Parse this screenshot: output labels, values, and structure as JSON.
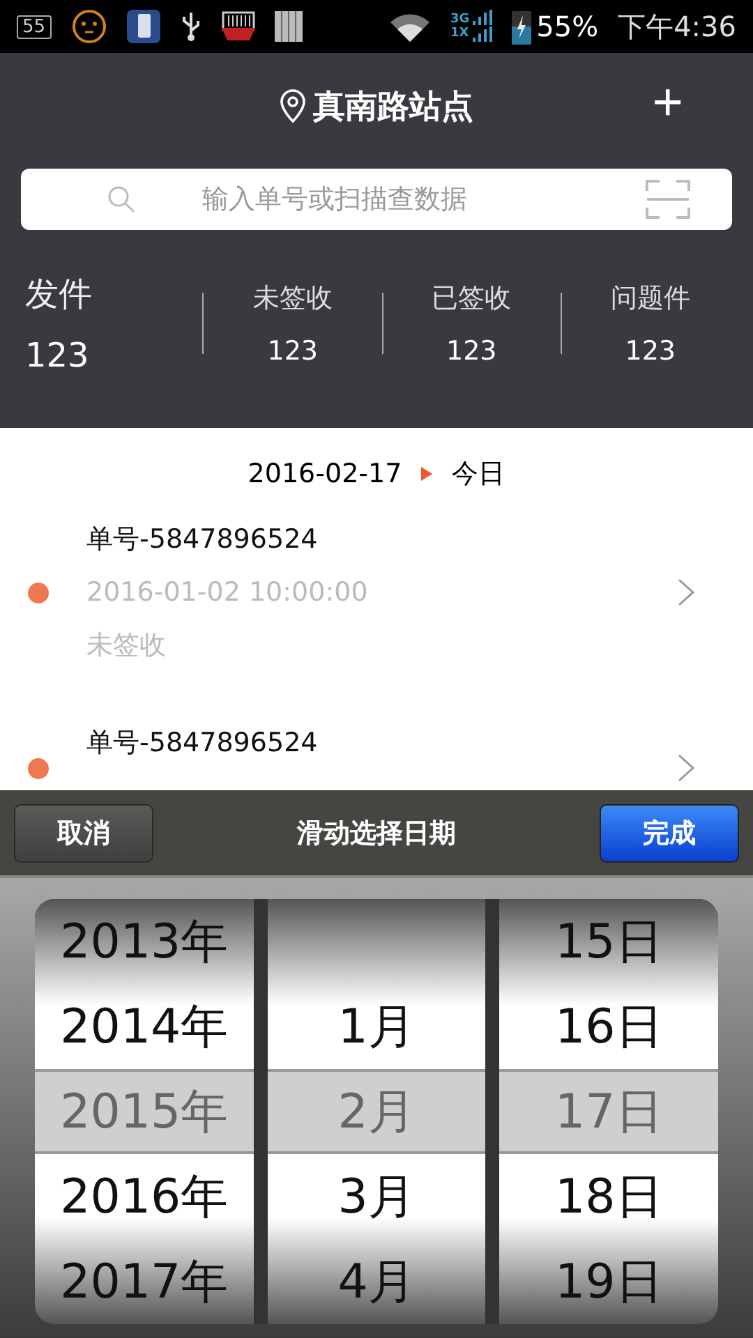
{
  "status_bar": {
    "notification_count": "55",
    "battery": "55%",
    "time": "下午4:36",
    "network_top": "3G",
    "network_bottom": "1X"
  },
  "header": {
    "title": "真南路站点",
    "add_button": "+"
  },
  "search": {
    "placeholder": "输入单号或扫描查数据"
  },
  "stats": [
    {
      "label": "发件",
      "count": "123",
      "selected": true
    },
    {
      "label": "未签收",
      "count": "123",
      "selected": false
    },
    {
      "label": "已签收",
      "count": "123",
      "selected": false
    },
    {
      "label": "问题件",
      "count": "123",
      "selected": false
    }
  ],
  "date_header": {
    "date": "2016-02-17",
    "label": "今日"
  },
  "orders": [
    {
      "number": "单号-5847896524",
      "time": "2016-01-02 10:00:00",
      "status": "未签收",
      "color": "#f07850"
    },
    {
      "number": "单号-5847896524",
      "color": "#f07850"
    }
  ],
  "picker": {
    "cancel": "取消",
    "title": "滑动选择日期",
    "done": "完成",
    "columns": [
      [
        {
          "text": "2013年",
          "selected": false
        },
        {
          "text": "2014年",
          "selected": false
        },
        {
          "text": "2015年",
          "selected": true
        },
        {
          "text": "2016年",
          "selected": false
        },
        {
          "text": "2017年",
          "selected": false
        }
      ],
      [
        {
          "selected": false
        },
        {
          "text": "1月",
          "selected": false
        },
        {
          "text": "2月",
          "selected": true
        },
        {
          "text": "3月",
          "selected": false
        },
        {
          "text": "4月",
          "selected": false
        }
      ],
      [
        {
          "text": "15日",
          "selected": false
        },
        {
          "text": "16日",
          "selected": false
        },
        {
          "text": "17日",
          "selected": true
        },
        {
          "text": "18日",
          "selected": false
        },
        {
          "text": "19日",
          "selected": false
        }
      ]
    ]
  }
}
